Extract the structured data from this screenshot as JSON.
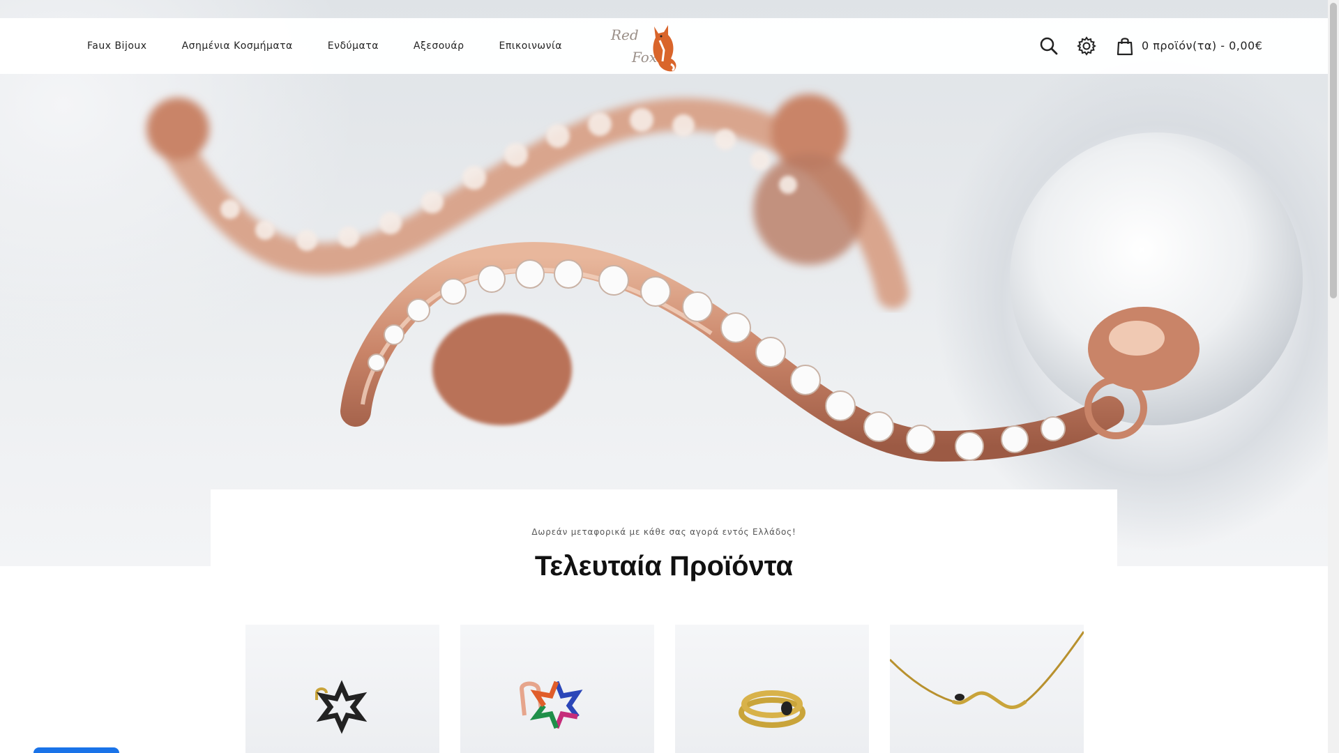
{
  "header": {
    "nav": [
      {
        "label": "Faux Bijoux"
      },
      {
        "label": "Ασημένια Κοσμήματα"
      },
      {
        "label": "Ενδύματα"
      },
      {
        "label": "Αξεσουάρ"
      },
      {
        "label": "Επικοινωνία"
      }
    ],
    "logo": {
      "line1": "Red",
      "line2": "Fox"
    },
    "icons": {
      "search": "search-icon",
      "settings": "gear-icon",
      "cart": "shopping-bag-icon"
    },
    "cart_label": "0 προϊόν(τα) - 0,00€"
  },
  "hero": {
    "image": "rose-gold crystal wave earrings with pearls"
  },
  "main": {
    "shipping_note": "Δωρεάν μεταφορικά με κάθε σας αγορά εντός Ελλάδος!",
    "section_title": "Τελευταία Προϊόντα",
    "products": [
      {
        "image": "black star earring"
      },
      {
        "image": "multicolor star earring"
      },
      {
        "image": "gold snake ring"
      },
      {
        "image": "gold snake necklace"
      }
    ]
  },
  "colors": {
    "rose_gold": "#c98a6e",
    "chat_blue": "#1a73e8"
  }
}
